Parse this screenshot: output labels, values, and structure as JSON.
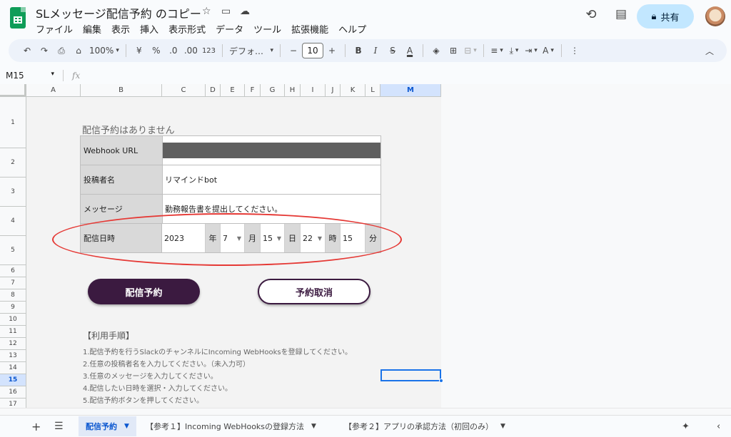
{
  "doc": {
    "title": "SLメッセージ配信予約 のコピー"
  },
  "menu": [
    "ファイル",
    "編集",
    "表示",
    "挿入",
    "表示形式",
    "データ",
    "ツール",
    "拡張機能",
    "ヘルプ"
  ],
  "share": {
    "label": "共有"
  },
  "toolbar": {
    "zoom": "100%",
    "currency": "¥",
    "percent": "%",
    "dec_decrease": ".0",
    "dec_increase": ".00",
    "number_format": "123",
    "font": "デフォ…",
    "font_size": "10",
    "minus": "−",
    "plus": "+",
    "bold": "B",
    "italic": "I",
    "strike": "S",
    "text_color": "A"
  },
  "formula_bar": {
    "cell_ref": "M15",
    "fx": "fx"
  },
  "columns": [
    "A",
    "B",
    "C",
    "D",
    "E",
    "F",
    "G",
    "H",
    "I",
    "J",
    "K",
    "L",
    "M"
  ],
  "rows": [
    "1",
    "2",
    "3",
    "4",
    "5",
    "6",
    "7",
    "8",
    "9",
    "10",
    "11",
    "12",
    "13",
    "14",
    "15",
    "16",
    "17"
  ],
  "form": {
    "status_message": "配信予約はありません",
    "webhook_label": "Webhook URL",
    "poster_label": "投稿者名",
    "poster_value": "リマインドbot",
    "message_label": "メッセージ",
    "message_value": "勤務報告書を提出してください。",
    "datetime_label": "配信日時",
    "year": "2023",
    "year_unit": "年",
    "month": "7",
    "month_unit": "月",
    "day": "15",
    "day_unit": "日",
    "hour": "22",
    "hour_unit": "時",
    "minute": "15",
    "minute_unit": "分"
  },
  "buttons": {
    "reserve": "配信予約",
    "cancel": "予約取消"
  },
  "instructions": {
    "heading": "【利用手順】",
    "steps": [
      "1.配信予約を行うSlackのチャンネルにIncoming WebHooksを登録してください。",
      "2.任意の投稿者名を入力してください。（未入力可）",
      "3.任意のメッセージを入力してください。",
      "4.配信したい日時を選択・入力してください。",
      "5.配信予約ボタンを押してください。"
    ]
  },
  "tabs": [
    {
      "label": "配信予約",
      "active": true
    },
    {
      "label": "【参考１】Incoming WebHooksの登録方法",
      "active": false
    },
    {
      "label": "【参考２】アプリの承認方法（初回のみ）",
      "active": false
    }
  ],
  "colors": {
    "accent": "#0b57d0",
    "button_dark": "#3b1a40",
    "highlight_ellipse": "#e53935",
    "share_bg": "#c2e7ff"
  }
}
